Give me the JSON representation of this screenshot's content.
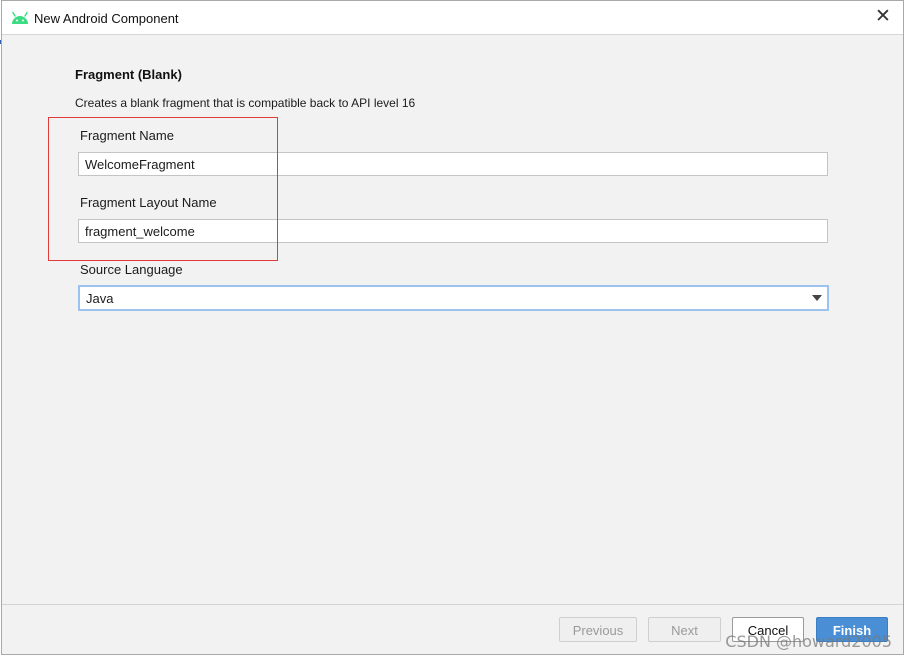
{
  "window": {
    "title": "New Android Component",
    "icon": "android-icon",
    "close_symbol": "✕"
  },
  "main": {
    "heading": "Fragment (Blank)",
    "description": "Creates a blank fragment that is compatible back to API level 16",
    "fragment_name": {
      "label": "Fragment Name",
      "value": "WelcomeFragment"
    },
    "fragment_layout_name": {
      "label": "Fragment Layout Name",
      "value": "fragment_welcome"
    },
    "source_language": {
      "label": "Source Language",
      "selected": "Java"
    }
  },
  "footer": {
    "previous_label": "Previous",
    "next_label": "Next",
    "cancel_label": "Cancel",
    "finish_label": "Finish"
  },
  "watermark": "CSDN @howard2005",
  "colors": {
    "accent": "#4a8fd6",
    "highlight": "#e03a3a",
    "android_green": "#3ddc84"
  }
}
